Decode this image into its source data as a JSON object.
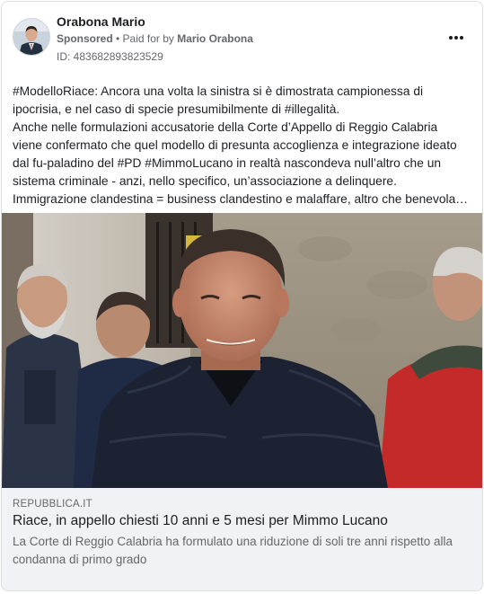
{
  "post": {
    "page_name": "Orabona Mario",
    "sponsored_label": "Sponsored",
    "paid_for_prefix": " • Paid for by ",
    "paid_for_name": "Mario Orabona",
    "ad_id": "ID: 483682893823529",
    "more_icon": "more-horizontal-icon",
    "body_lines": [
      "#ModelloRiace: Ancora una volta la sinistra si è dimostrata campionessa di",
      "ipocrisia, e nel caso di specie presumibilmente di #illegalità.",
      "Anche nelle formulazioni accusatorie della Corte d’Appello di Reggio Calabria",
      "viene confermato che quel modello di presunta accoglienza e integrazione ideato",
      "dal fu-paladino del #PD #MimmoLucano in realtà nascondeva null’altro che un",
      "sistema criminale - anzi, nello specifico, un’associazione a delinquere.",
      "Immigrazione clandestina = business clandestino e malaffare, altro che benevola…"
    ]
  },
  "link_preview": {
    "domain": "REPUBBLICA.IT",
    "title": "Riace, in appello chiesti 10 anni e 5 mesi per Mimmo Lucano",
    "description_lines": [
      "La Corte di Reggio Calabria ha formulato una riduzione di soli tre anni rispetto alla",
      "condanna di primo grado"
    ]
  }
}
